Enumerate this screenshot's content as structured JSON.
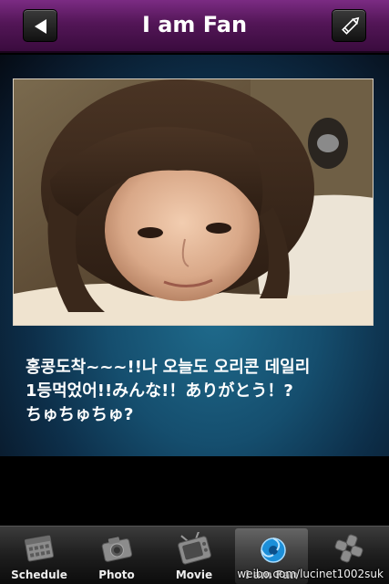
{
  "header": {
    "title": "I am Fan",
    "back_icon": "back-arrow-icon",
    "edit_icon": "pencil-icon"
  },
  "post": {
    "photo_alt": "selfie photo",
    "caption": "홍콩도착~~~!!나 오늘도 오리콘 데일리\n1등먹었어!!みんな!！ありがとう！?\nちゅちゅちゅ?"
  },
  "tabs": [
    {
      "label": "Schedule",
      "icon": "calendar-icon"
    },
    {
      "label": "Photo",
      "icon": "camera-icon"
    },
    {
      "label": "Movie",
      "icon": "tv-icon"
    },
    {
      "label": "I am Fan",
      "icon": "fan-icon",
      "active": true
    },
    {
      "label": "",
      "icon": "clover-icon"
    }
  ],
  "watermark": "weibo.com/lucinet1002suk",
  "colors": {
    "header_purple": "#531657",
    "content_teal": "#1f6b8c",
    "tabbar_dark": "#1e1e1e"
  }
}
